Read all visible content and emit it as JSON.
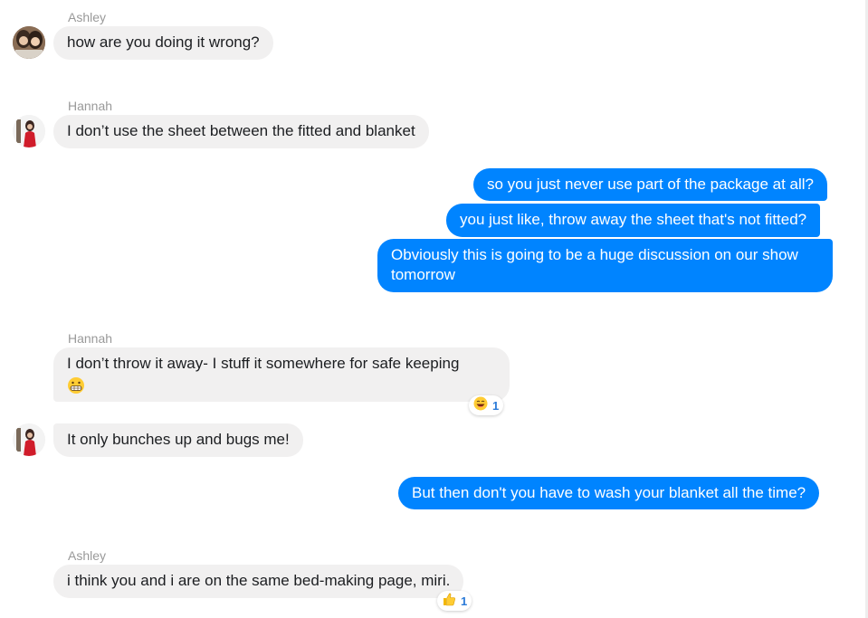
{
  "messages": [
    {
      "sender": "Ashley",
      "text": "how are you doing it wrong?"
    },
    {
      "sender": "Hannah",
      "text": "I don’t use the sheet between the fitted and blanket"
    },
    {
      "text": "so you just never use part of the package at all?"
    },
    {
      "text": "you just like, throw away the sheet that's not fitted?"
    },
    {
      "text": "Obviously this is going to be a huge discussion on our show tomorrow"
    },
    {
      "sender": "Hannah",
      "text": "I don’t throw it away- I stuff it somewhere for safe keeping",
      "emoji": "grimacing-face-icon",
      "reaction": {
        "icon": "laughing-face-icon",
        "count": "1"
      }
    },
    {
      "text": "It only bunches up and bugs me!"
    },
    {
      "text": "But then don't you have to wash your blanket all the time?"
    },
    {
      "sender": "Ashley",
      "text": "i think you and i are on the same bed-making page, miri.",
      "reaction": {
        "icon": "thumbs-up-icon",
        "count": "1"
      }
    }
  ],
  "colors": {
    "outgoing_bubble": "#0084ff",
    "incoming_bubble": "#f1f0f0",
    "sender_name": "#999999",
    "reaction_count": "#2a7ad8"
  }
}
